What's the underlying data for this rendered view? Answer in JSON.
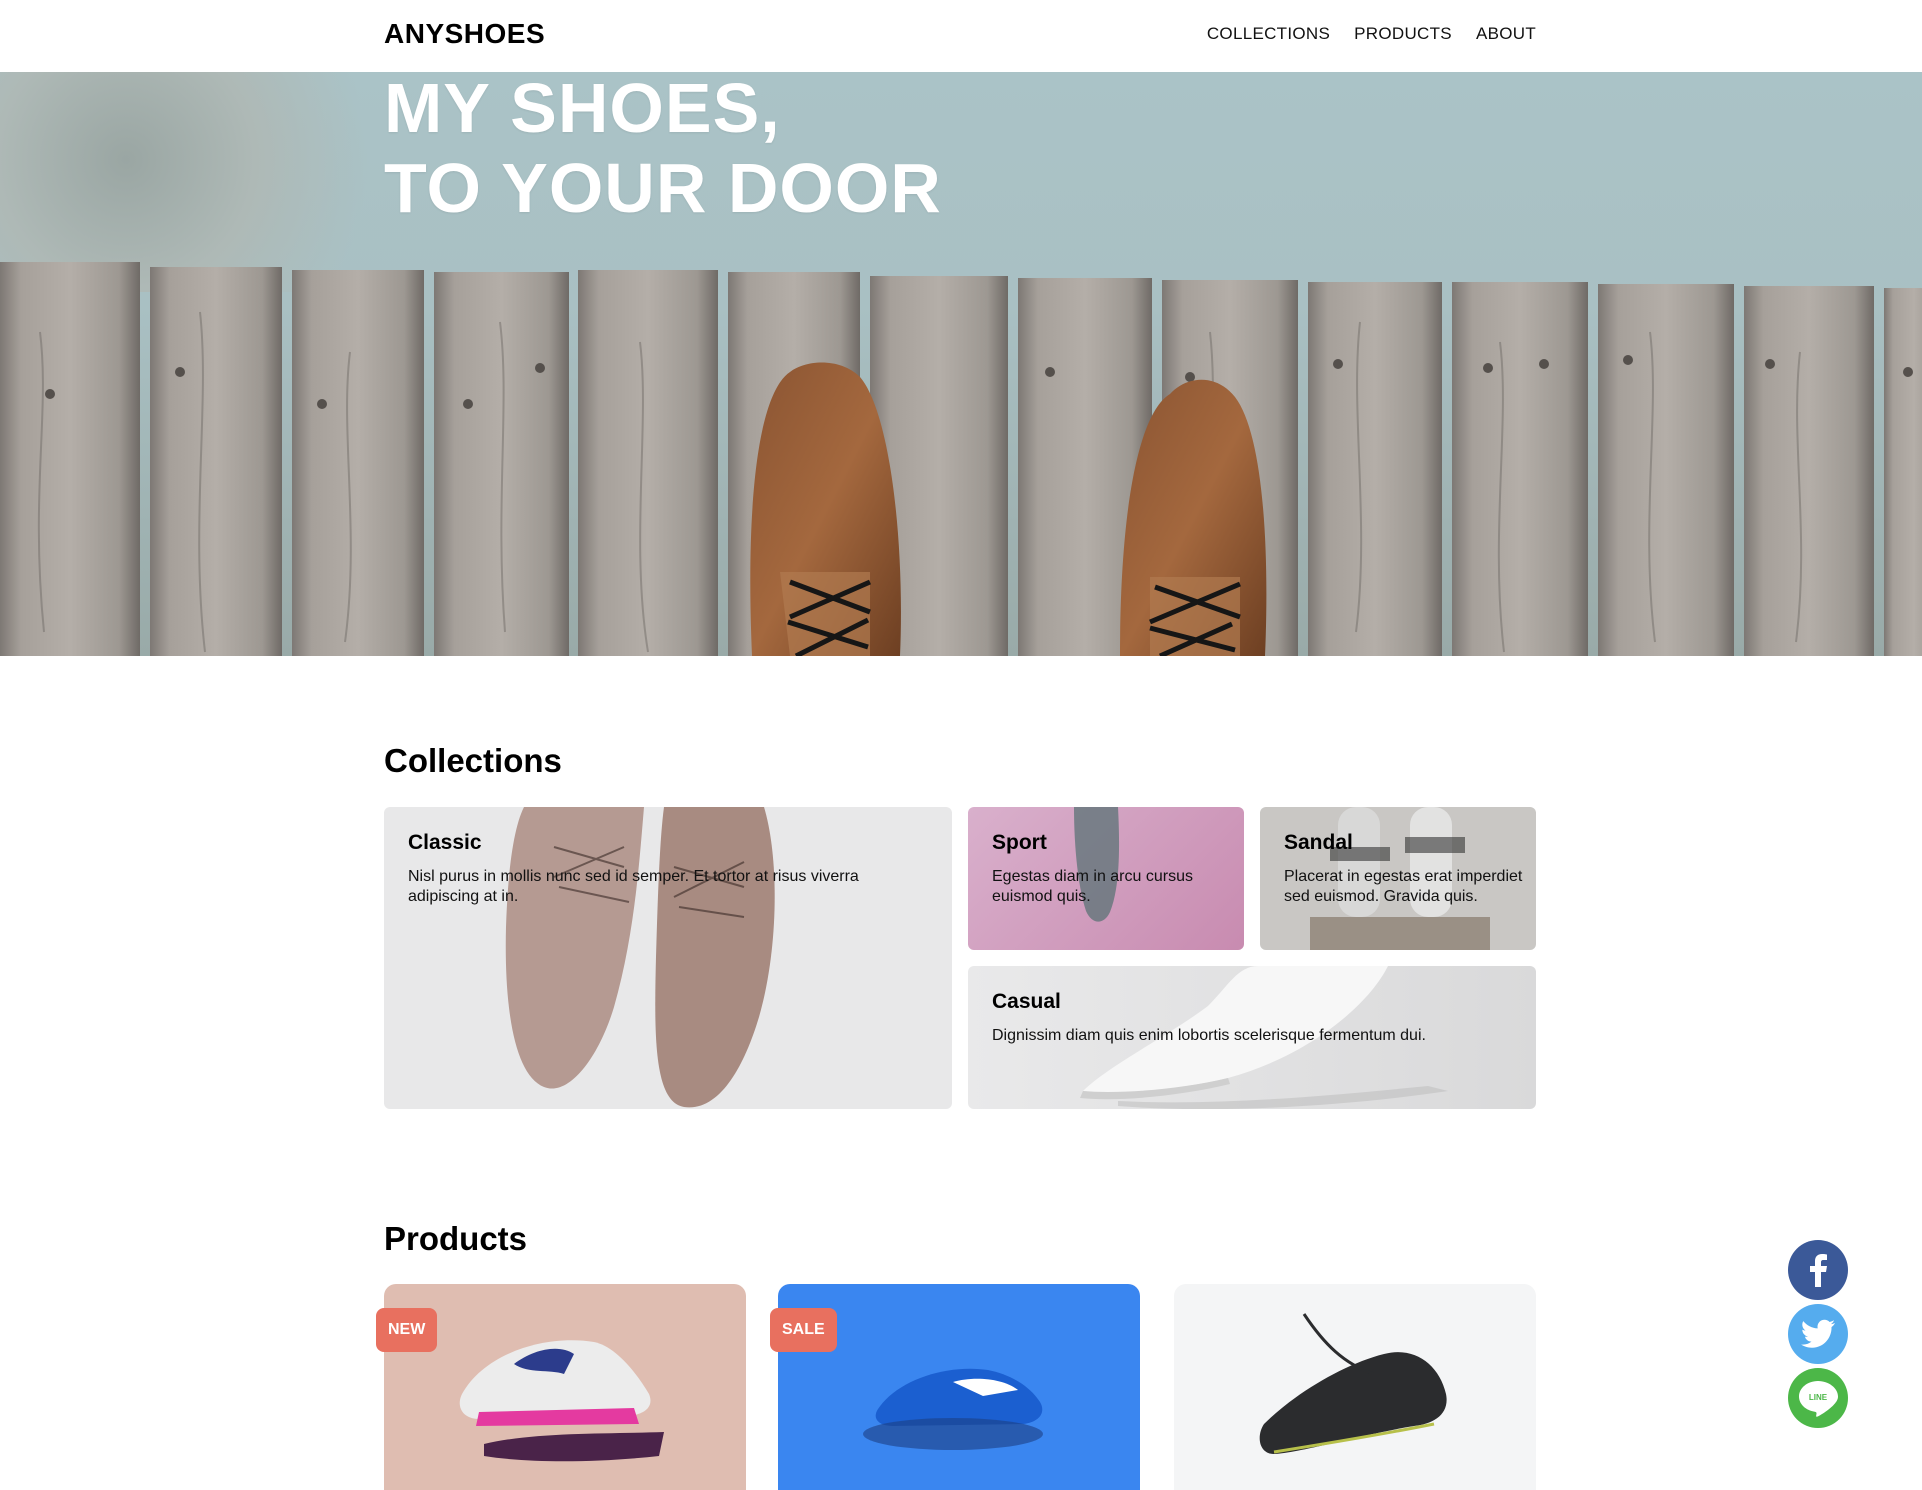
{
  "header": {
    "brand": "ANYSHOES",
    "nav": [
      "COLLECTIONS",
      "PRODUCTS",
      "ABOUT"
    ]
  },
  "hero": {
    "title_line1": "MY SHOES,",
    "title_line2": "TO YOUR DOOR"
  },
  "collections": {
    "title": "Collections",
    "items": [
      {
        "name": "Classic",
        "desc": "Nisl purus in mollis nunc sed id semper. Et tortor at risus viverra adipiscing at in."
      },
      {
        "name": "Sport",
        "desc": "Egestas diam in arcu cursus euismod quis."
      },
      {
        "name": "Sandal",
        "desc": "Placerat in egestas erat imperdiet sed euismod. Gravida quis."
      },
      {
        "name": "Casual",
        "desc": "Dignissim diam quis enim lobortis scelerisque fermentum dui."
      }
    ]
  },
  "products": {
    "title": "Products",
    "badges": [
      "NEW",
      "SALE"
    ]
  },
  "social": [
    "facebook-icon",
    "twitter-icon",
    "line-icon"
  ],
  "colors": {
    "badge": "#e8705f",
    "facebook": "#3b5998",
    "twitter": "#55acee",
    "line": "#4cb748",
    "sport_bg": "#cf9fbd",
    "product_pink": "#dfbdb1",
    "product_blue": "#3a86f0"
  }
}
